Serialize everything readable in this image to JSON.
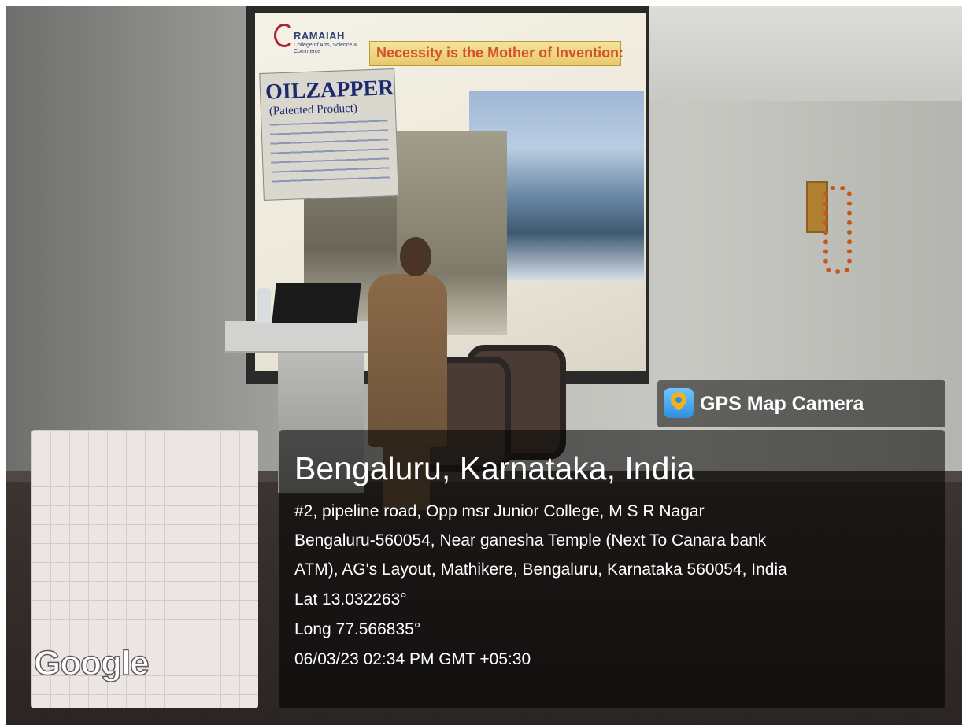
{
  "slide": {
    "logo_name": "RAMAIAH",
    "logo_sub": "College of Arts, Science & Commerce",
    "title": "Necessity is the Mother of Invention:",
    "poster_brand": "OILZAPPER",
    "poster_sub": "(Patented Product)"
  },
  "overlay": {
    "app_name": "GPS Map Camera",
    "map_provider": "Google",
    "location_title": "Bengaluru, Karnataka, India",
    "address_lines": [
      "#2, pipeline road, Opp msr Junior College, M S R Nagar",
      "Bengaluru-560054, Near ganesha Temple (Next To Canara bank",
      "ATM), AG's Layout, Mathikere, Bengaluru, Karnataka 560054, India"
    ],
    "latitude": "Lat 13.032263°",
    "longitude": "Long 77.566835°",
    "timestamp": "06/03/23 02:34 PM GMT +05:30"
  },
  "colors": {
    "overlay_bg": "#000000",
    "gps_icon": "#2f8fe0",
    "slide_title": "#d8502a"
  }
}
